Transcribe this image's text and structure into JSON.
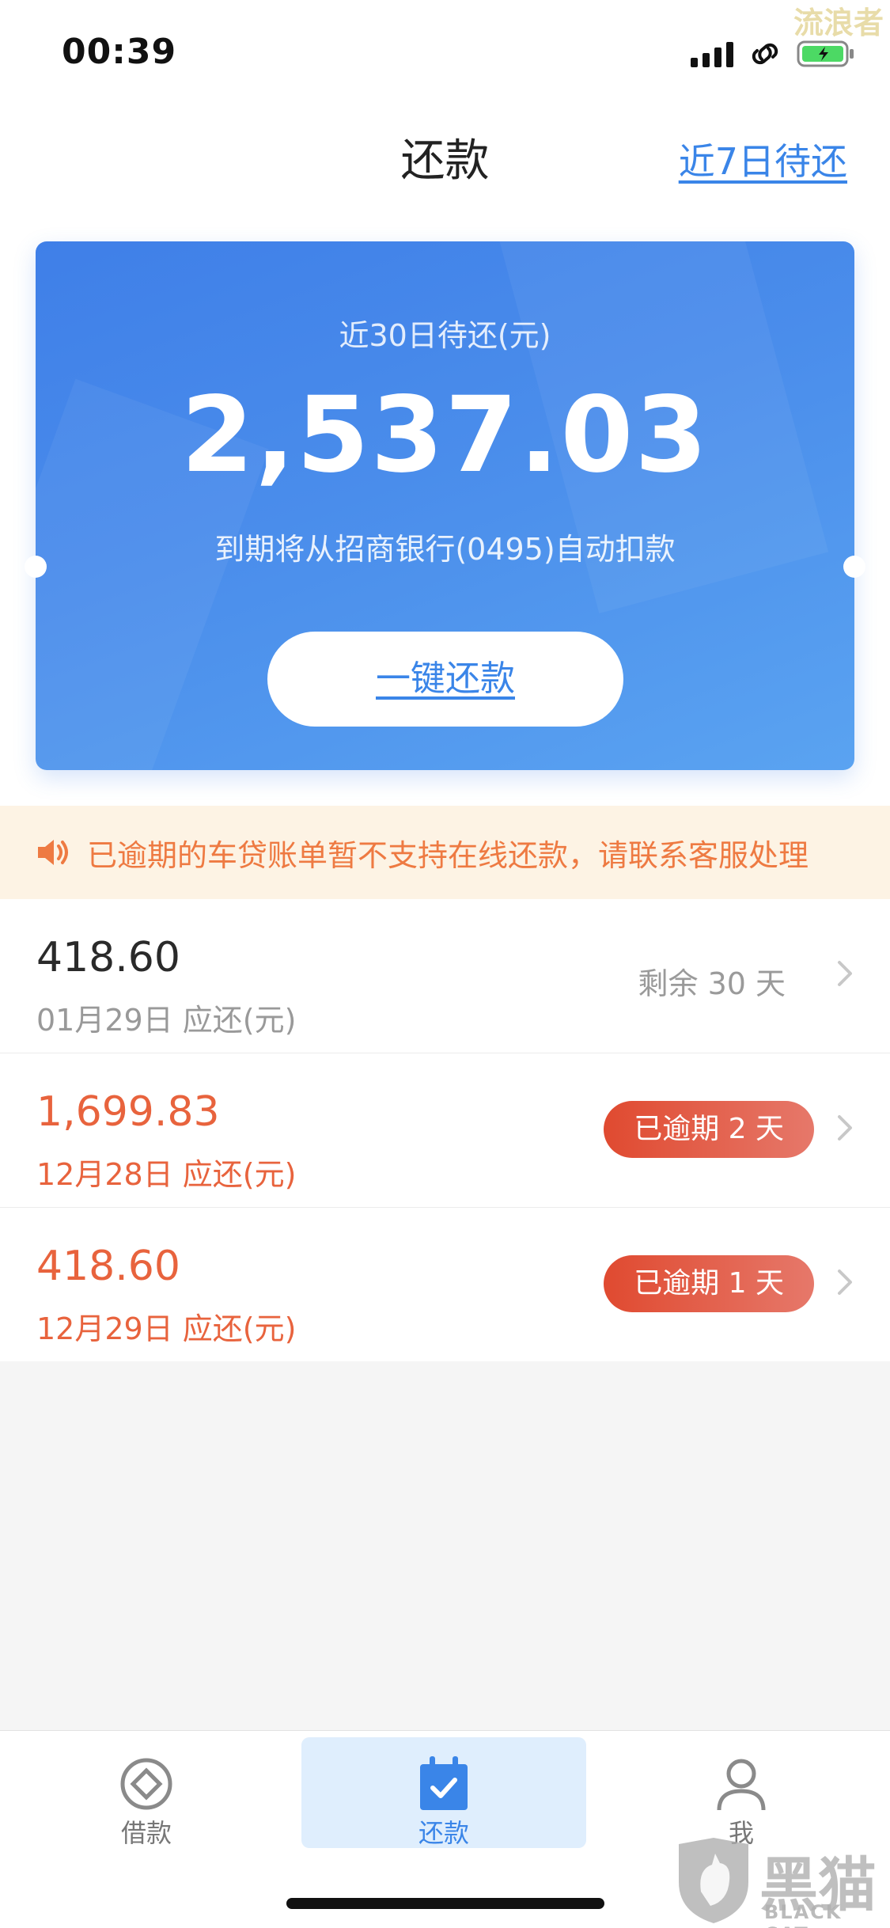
{
  "status_bar": {
    "time": "00:39",
    "watermark": "流浪者"
  },
  "nav": {
    "title": "还款",
    "link": "近7日待还"
  },
  "summary_card": {
    "label": "近30日待还(元)",
    "amount": "2,537.03",
    "description": "到期将从招商银行(0495)自动扣款",
    "button_label": "一键还款"
  },
  "notice": {
    "text": "已逾期的车贷账单暂不支持在线还款，请联系客服处理"
  },
  "bills": [
    {
      "amount": "418.60",
      "date": "01月29日 应还(元)",
      "status": "剩余 30 天",
      "overdue": false
    },
    {
      "amount": "1,699.83",
      "date": "12月28日 应还(元)",
      "status": "已逾期 2 天",
      "overdue": true
    },
    {
      "amount": "418.60",
      "date": "12月29日 应还(元)",
      "status": "已逾期 1 天",
      "overdue": true
    }
  ],
  "tabbar": {
    "tabs": [
      {
        "label": "借款",
        "icon": "loan-icon",
        "active": false
      },
      {
        "label": "还款",
        "icon": "repay-calendar-icon",
        "active": true
      },
      {
        "label": "我",
        "icon": "profile-icon",
        "active": false
      }
    ]
  },
  "watermark": {
    "brand": "黑猫",
    "sub": "BLACK CAT"
  },
  "colors": {
    "accent": "#3a85e8",
    "overdue": "#e8633d",
    "notice_bg": "#fdf3e4"
  }
}
